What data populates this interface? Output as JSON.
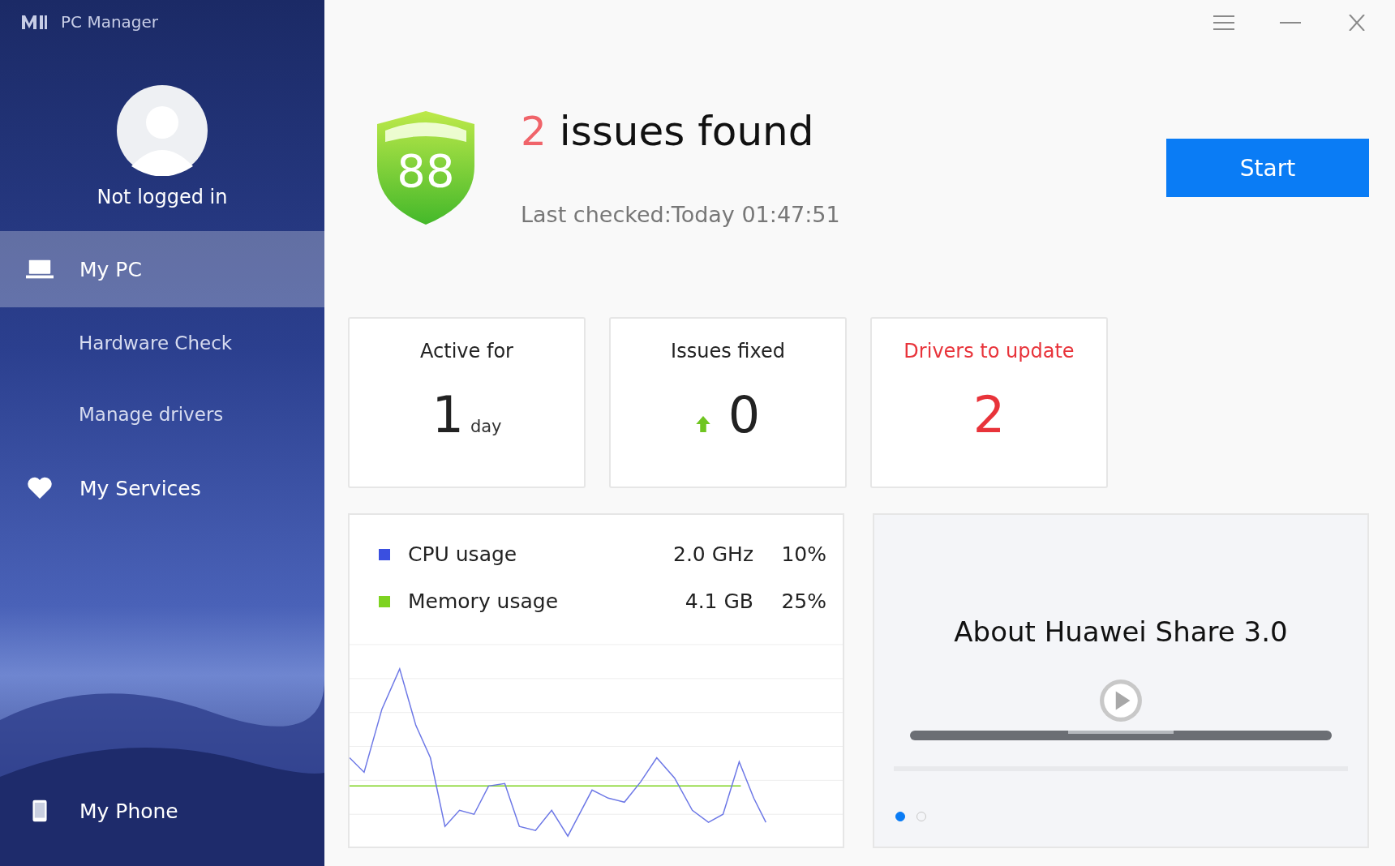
{
  "app": {
    "title": "PC Manager"
  },
  "user": {
    "name": "Not logged in"
  },
  "sidebar": {
    "items": [
      {
        "label": "My PC",
        "selected": true,
        "children": [
          {
            "label": "Hardware Check",
            "selected": false
          },
          {
            "label": "Manage drivers",
            "selected": false
          }
        ]
      },
      {
        "label": "My Services",
        "selected": false
      },
      {
        "label": "My Phone",
        "selected": false
      }
    ]
  },
  "scan": {
    "score": "88",
    "issue_count": "2",
    "issue_text": "issues found",
    "last_checked": "Last checked:Today 01:47:51",
    "button": "Start"
  },
  "stats": [
    {
      "title": "Active for",
      "value": "1",
      "unit": "day",
      "alert": false,
      "rising": false
    },
    {
      "title": "Issues fixed",
      "value": "0",
      "alert": false,
      "rising": true
    },
    {
      "title": "Drivers to update",
      "value": "2",
      "alert": true,
      "rising": false
    }
  ],
  "usage": [
    {
      "name": "CPU usage",
      "amount": "2.0 GHz",
      "percent": "10%",
      "color": "#3a4fe0"
    },
    {
      "name": "Memory usage",
      "amount": "4.1 GB",
      "percent": "25%",
      "color": "#7ed321"
    }
  ],
  "promo": {
    "title": "About Huawei Share 3.0",
    "pages": [
      {
        "selected": true
      },
      {
        "selected": false
      }
    ]
  }
}
